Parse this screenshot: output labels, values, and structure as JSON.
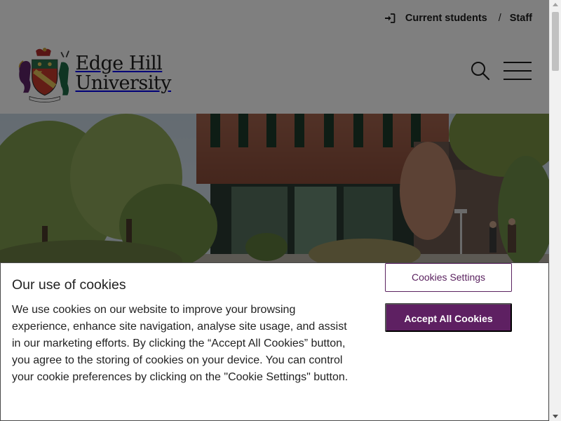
{
  "header": {
    "current_students": "Current students",
    "separator": "/",
    "staff": "Staff",
    "logo_line1": "Edge Hill",
    "logo_line2": "University",
    "search_icon": "search-icon",
    "menu_icon": "hamburger-menu-icon",
    "login_icon": "sign-in-icon"
  },
  "hero": {
    "image": "campus-building-photo"
  },
  "cookie_banner": {
    "title": "Our use of cookies",
    "body": "We use cookies on our website to improve your browsing experience, enhance site navigation, analyse site usage, and assist in our marketing efforts. By clicking the “Accept All Cookies” button, you agree to the storing of cookies on your device. You can control your cookie preferences by clicking on the \"Cookie Settings\" button.",
    "settings_label": "Cookies Settings",
    "accept_label": "Accept All Cookies"
  },
  "colors": {
    "brand_purple": "#5e2062",
    "overlay": "rgba(0,0,0,0.5)"
  }
}
